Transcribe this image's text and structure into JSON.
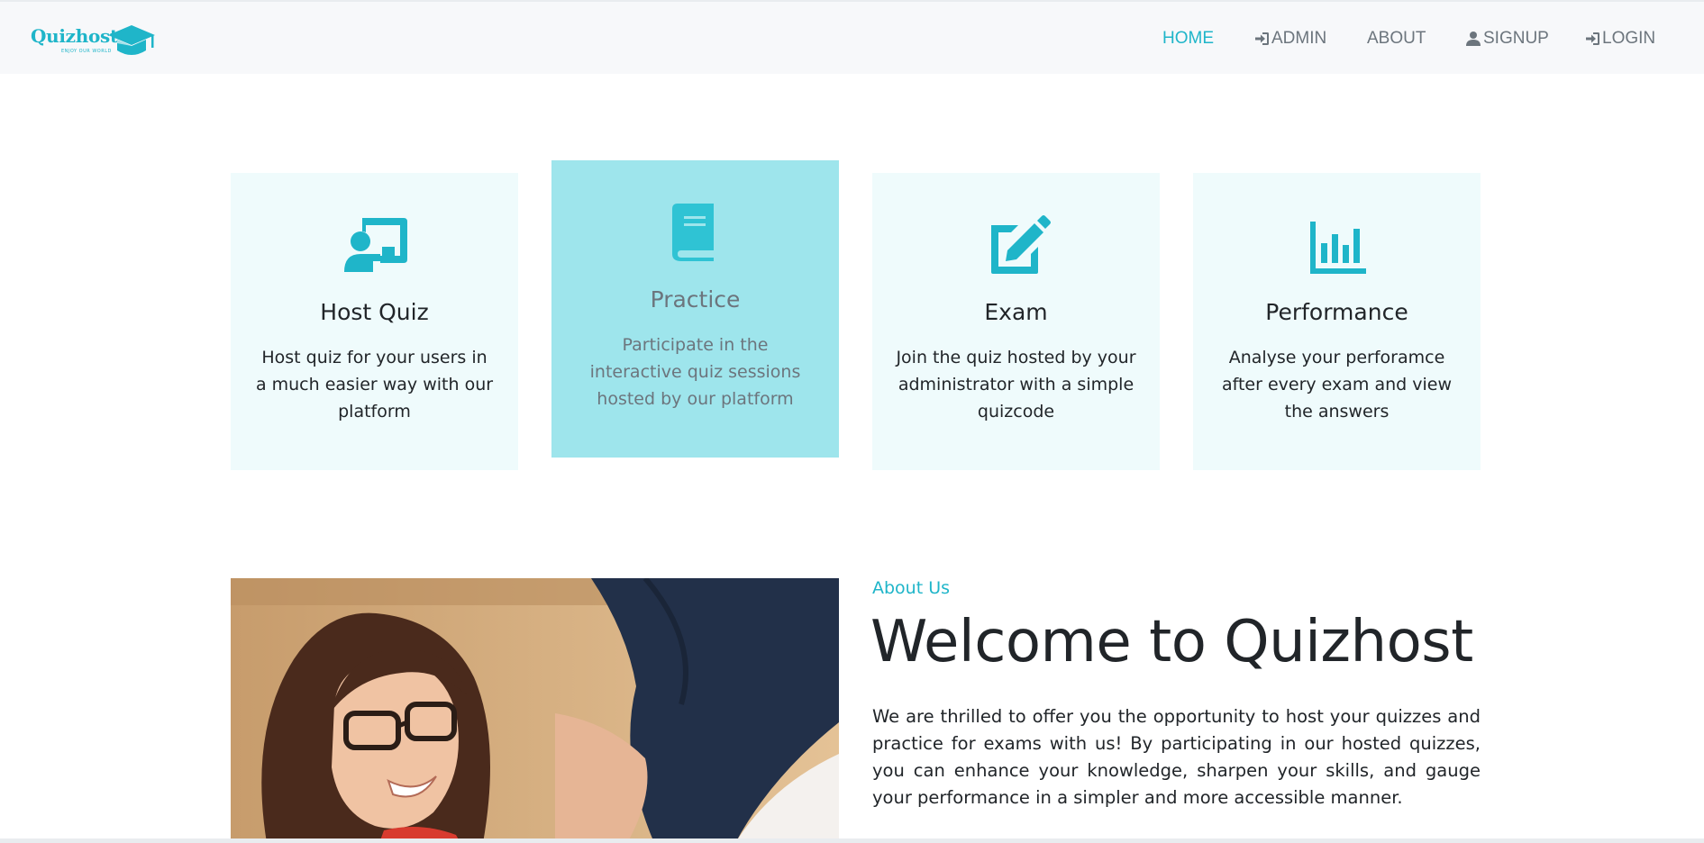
{
  "header": {
    "logo_text": "Quizhost",
    "logo_tagline": "ENJOY OUR WORLD",
    "nav": [
      {
        "label": "HOME",
        "icon": "none",
        "active": true
      },
      {
        "label": "ADMIN",
        "icon": "sign-in-icon",
        "active": false
      },
      {
        "label": "ABOUT",
        "icon": "none",
        "active": false
      },
      {
        "label": "SIGNUP",
        "icon": "user-icon",
        "active": false
      },
      {
        "label": "LOGIN",
        "icon": "sign-in-icon",
        "active": false
      }
    ]
  },
  "features": [
    {
      "title": "Host Quiz",
      "desc": "Host quiz for your users in a much easier way with our platform",
      "icon": "chalkboard-teacher-icon"
    },
    {
      "title": "Practice",
      "desc": "Participate in the interactive quiz sessions hosted by our platform",
      "icon": "book-icon"
    },
    {
      "title": "Exam",
      "desc": "Join the quiz hosted by your administrator with a simple quizcode",
      "icon": "edit-icon"
    },
    {
      "title": "Performance",
      "desc": "Analyse your perforamce after every exam and view the answers",
      "icon": "bar-chart-icon"
    }
  ],
  "about": {
    "kicker": "About Us",
    "title": "Welcome to Quizhost",
    "text": "We are thrilled to offer you the opportunity to host your quizzes and practice for exams with us! By participating in our hosted quizzes, you can enhance your knowledge, sharpen your skills, and gauge your performance in a simpler and more accessible manner."
  },
  "colors": {
    "accent": "#1fb5c9",
    "card_bg": "#effbfc",
    "card_highlight_bg": "#9ee5ec",
    "header_bg": "#f7f8fa"
  }
}
